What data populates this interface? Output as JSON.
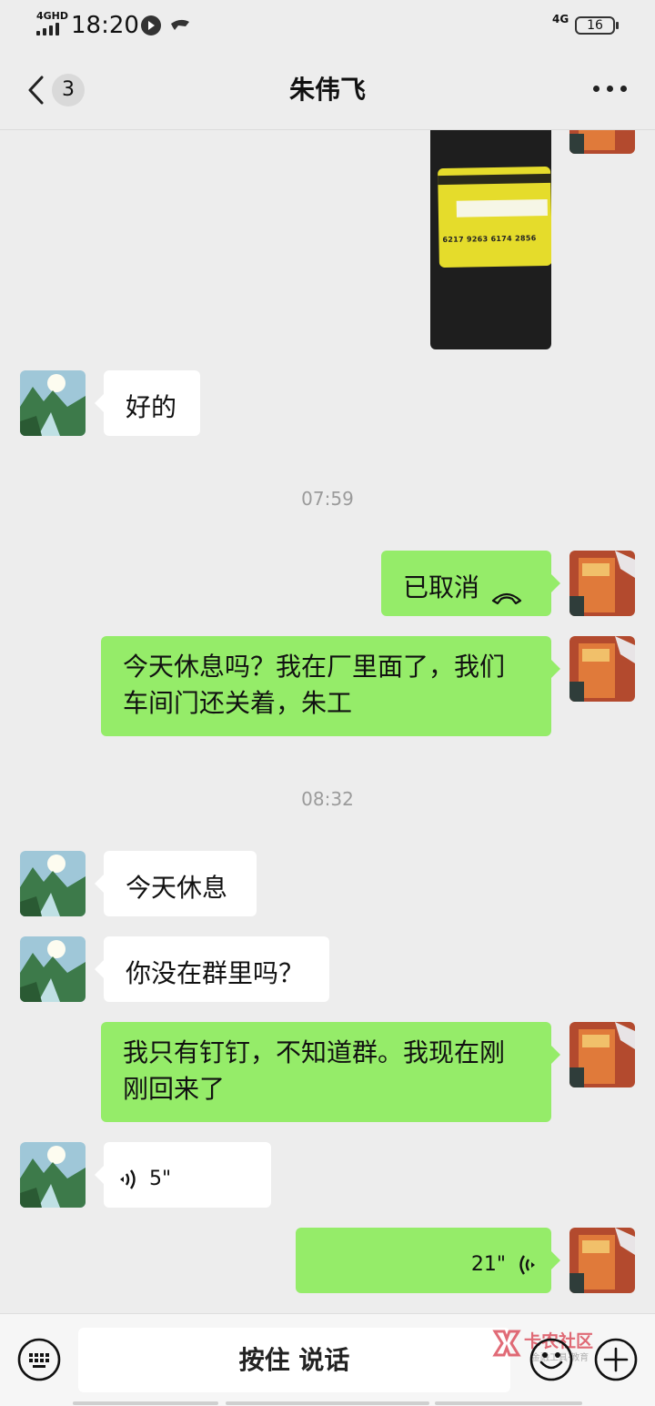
{
  "status_bar": {
    "network": "4GHD",
    "time": "18:20",
    "network_right": "4G",
    "battery": "16"
  },
  "nav": {
    "unread_count": "3",
    "title": "朱伟飞"
  },
  "messages": [
    {
      "type": "image",
      "side": "right",
      "content": "bank card photo",
      "card_number": "6217 9263 6174 2856"
    },
    {
      "type": "text",
      "side": "left",
      "text": "好的"
    },
    {
      "type": "timestamp",
      "text": "07:59"
    },
    {
      "type": "call",
      "side": "right",
      "text": "已取消"
    },
    {
      "type": "text",
      "side": "right",
      "text": "今天休息吗？我在厂里面了，我们车间门还关着，朱工"
    },
    {
      "type": "timestamp",
      "text": "08:32"
    },
    {
      "type": "text",
      "side": "left",
      "text": "今天休息"
    },
    {
      "type": "text",
      "side": "left",
      "text": "你没在群里吗？"
    },
    {
      "type": "text",
      "side": "right",
      "text": "我只有钉钉，不知道群。我现在刚刚回来了"
    },
    {
      "type": "voice",
      "side": "left",
      "duration": "5\""
    },
    {
      "type": "voice",
      "side": "right",
      "duration": "21\""
    }
  ],
  "bottom_bar": {
    "hold_to_talk": "按住 说话",
    "watermark": "卡农社区",
    "watermark_sub": "金融工具·教育"
  },
  "colors": {
    "sent_bubble": "#95ec69",
    "received_bubble": "#ffffff",
    "background": "#ededed"
  }
}
